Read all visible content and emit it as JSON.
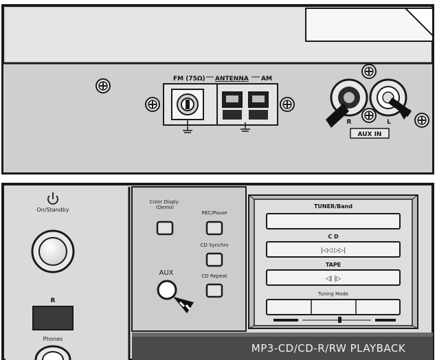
{
  "top_panel": {
    "antenna": {
      "fm_label": "FM (75Ω)",
      "section_label": "ANTENNA",
      "am_label": "AM"
    },
    "aux_in": {
      "r_label": "R",
      "l_label": "L",
      "section_label": "AUX IN"
    }
  },
  "front_panel": {
    "power": {
      "label": "On/Standby"
    },
    "remote_sensor_label": "R",
    "phones_label": "Phones",
    "buttons": {
      "color_display": "Color Disply (Demo)",
      "rec_pause": "REC/Pause",
      "cd_synchro": "CD Synchro",
      "cd_repeat": "CD Repeat",
      "aux": "AUX"
    },
    "display": {
      "tuner": "TUNER/Band",
      "cd": "C D",
      "cd_symbol": "|◁◁ ▷▷|",
      "tape": "TAPE",
      "tape_symbol": "◁| |▷",
      "tuning_mode": "Tuning Mode"
    },
    "banner": "MP3-CD/CD-R/RW PLAYBACK"
  },
  "colors": {
    "panel": "#d6d6d6",
    "outline": "#1a1a1a",
    "banner": "#444444"
  },
  "icons": [
    "screw-icon",
    "power-icon",
    "arrow-pointer-icon"
  ]
}
